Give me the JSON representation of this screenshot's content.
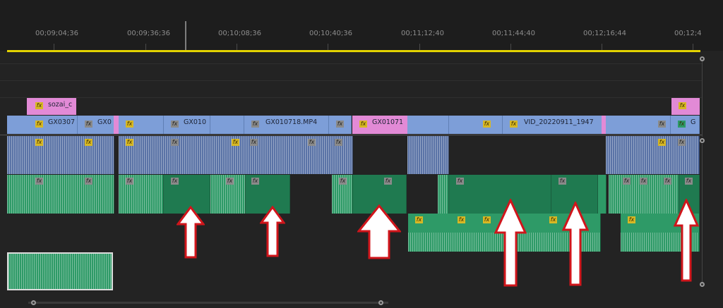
{
  "ruler": {
    "timecodes": [
      "00;09;04;36",
      "00;09;36;36",
      "00;10;08;36",
      "00;10;40;36",
      "00;11;12;40",
      "00;11;44;40",
      "00;12;16;44",
      "00;12;4"
    ]
  },
  "tracks": {
    "title_clips": [
      {
        "label": "sozai_c"
      }
    ],
    "video_clips": [
      {
        "label": "GX0307"
      },
      {
        "label": "GX0"
      },
      {
        "label": "GX010"
      },
      {
        "label": "GX010718.MP4"
      },
      {
        "label": "GX01071"
      },
      {
        "label": "VID_20220911_1947"
      },
      {
        "label": "G"
      }
    ]
  },
  "annotation": {
    "arrow_color": "#d0151b",
    "arrow_fill": "#ffffff"
  },
  "colors": {
    "video_clip": "#7d9ed8",
    "audio_blue": "#5a73a6",
    "audio_green": "#2e9a67",
    "title_pink": "#e28ad6",
    "work_area": "#e3d300",
    "fx_badge": "#d7b825"
  }
}
